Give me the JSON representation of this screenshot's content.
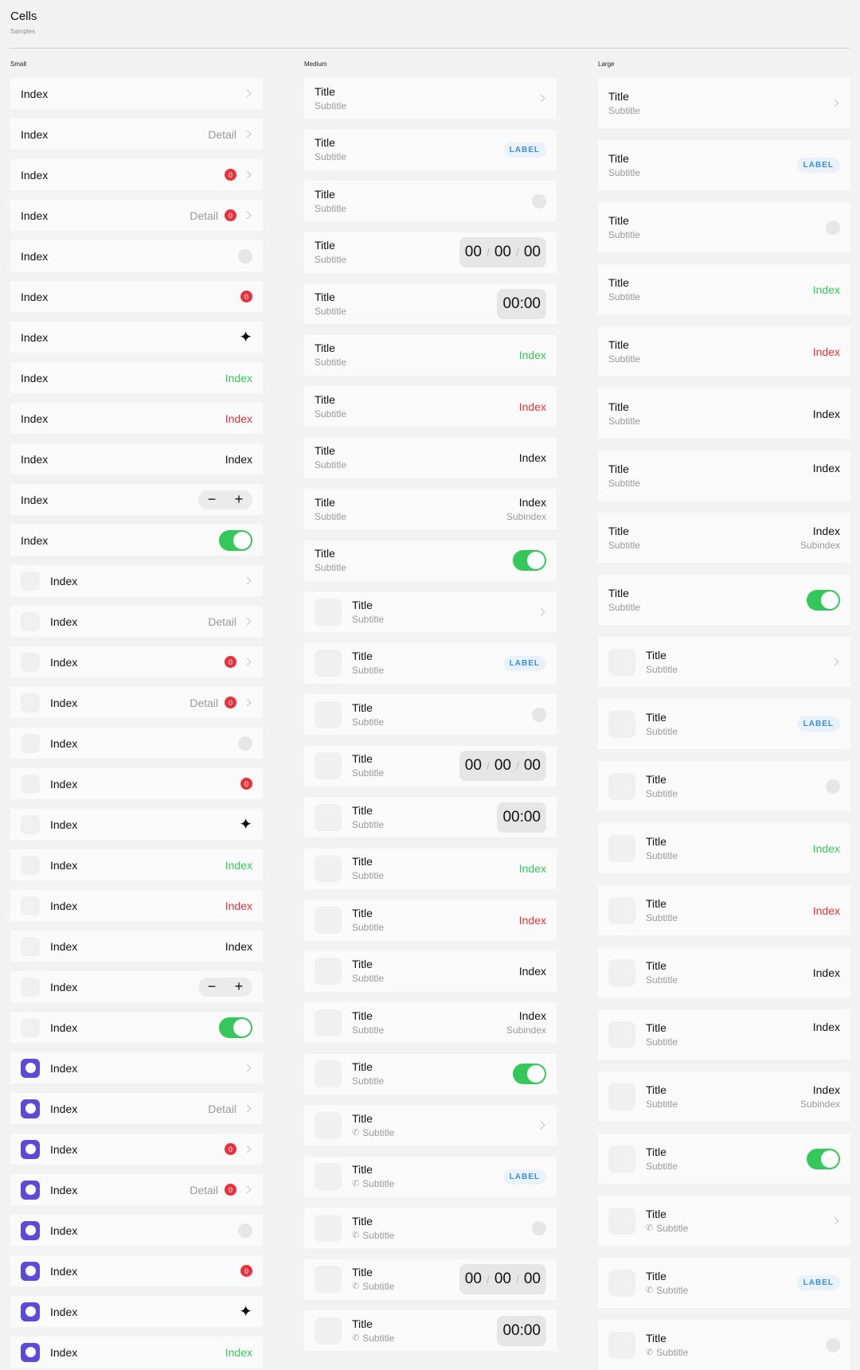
{
  "header": {
    "title": "Cells",
    "subtitle": "Samples"
  },
  "columns": {
    "small": "Small",
    "medium": "Medium",
    "large": "Large"
  },
  "common": {
    "index": "Index",
    "title": "Title",
    "subtitle": "Subtitle",
    "detail": "Detail",
    "badge": "0",
    "label": "LABEL",
    "subindex": "Subindex",
    "timer_h": "00",
    "timer_m": "00",
    "timer_s": "00",
    "timer_short": "00:00",
    "minus": "−",
    "plus": "+",
    "sparkle": "✦"
  },
  "colors": {
    "accent_green": "#34c759",
    "accent_red": "#e8313a",
    "label_blue": "#3a8fd9",
    "icon_purple": "#5b4bd8"
  },
  "small_rows": [
    {
      "thumb": "none",
      "right": "chevron"
    },
    {
      "thumb": "none",
      "right": "detail-chevron"
    },
    {
      "thumb": "none",
      "right": "badge-chevron"
    },
    {
      "thumb": "none",
      "right": "detail-badge-chevron"
    },
    {
      "thumb": "none",
      "right": "radio"
    },
    {
      "thumb": "none",
      "right": "badge"
    },
    {
      "thumb": "none",
      "right": "sparkle"
    },
    {
      "thumb": "none",
      "right": "value-green"
    },
    {
      "thumb": "none",
      "right": "value-red"
    },
    {
      "thumb": "none",
      "right": "value"
    },
    {
      "thumb": "none",
      "right": "stepper"
    },
    {
      "thumb": "none",
      "right": "toggle"
    },
    {
      "thumb": "grey",
      "right": "chevron"
    },
    {
      "thumb": "grey",
      "right": "detail-chevron"
    },
    {
      "thumb": "grey",
      "right": "badge-chevron"
    },
    {
      "thumb": "grey",
      "right": "detail-badge-chevron"
    },
    {
      "thumb": "grey",
      "right": "radio"
    },
    {
      "thumb": "grey",
      "right": "badge"
    },
    {
      "thumb": "grey",
      "right": "sparkle"
    },
    {
      "thumb": "grey",
      "right": "value-green"
    },
    {
      "thumb": "grey",
      "right": "value-red"
    },
    {
      "thumb": "grey",
      "right": "value"
    },
    {
      "thumb": "grey",
      "right": "stepper"
    },
    {
      "thumb": "grey",
      "right": "toggle"
    },
    {
      "thumb": "purple",
      "right": "chevron"
    },
    {
      "thumb": "purple",
      "right": "detail-chevron"
    },
    {
      "thumb": "purple",
      "right": "badge-chevron"
    },
    {
      "thumb": "purple",
      "right": "detail-badge-chevron"
    },
    {
      "thumb": "purple",
      "right": "radio"
    },
    {
      "thumb": "purple",
      "right": "badge"
    },
    {
      "thumb": "purple",
      "right": "sparkle"
    },
    {
      "thumb": "purple",
      "right": "value-green"
    }
  ],
  "medium_rows": [
    {
      "thumb": "none",
      "phone": false,
      "right": "chevron"
    },
    {
      "thumb": "none",
      "phone": false,
      "right": "label"
    },
    {
      "thumb": "none",
      "phone": false,
      "right": "radio"
    },
    {
      "thumb": "none",
      "phone": false,
      "right": "timer-long"
    },
    {
      "thumb": "none",
      "phone": false,
      "right": "timer-short"
    },
    {
      "thumb": "none",
      "phone": false,
      "right": "value-green"
    },
    {
      "thumb": "none",
      "phone": false,
      "right": "value-red"
    },
    {
      "thumb": "none",
      "phone": false,
      "right": "value"
    },
    {
      "thumb": "none",
      "phone": false,
      "right": "value-sub"
    },
    {
      "thumb": "none",
      "phone": false,
      "right": "toggle"
    },
    {
      "thumb": "grey",
      "phone": false,
      "right": "chevron"
    },
    {
      "thumb": "grey",
      "phone": false,
      "right": "label"
    },
    {
      "thumb": "grey",
      "phone": false,
      "right": "radio"
    },
    {
      "thumb": "grey",
      "phone": false,
      "right": "timer-long"
    },
    {
      "thumb": "grey",
      "phone": false,
      "right": "timer-short"
    },
    {
      "thumb": "grey",
      "phone": false,
      "right": "value-green"
    },
    {
      "thumb": "grey",
      "phone": false,
      "right": "value-red"
    },
    {
      "thumb": "grey",
      "phone": false,
      "right": "value"
    },
    {
      "thumb": "grey",
      "phone": false,
      "right": "value-sub"
    },
    {
      "thumb": "grey",
      "phone": false,
      "right": "toggle"
    },
    {
      "thumb": "grey",
      "phone": true,
      "right": "chevron"
    },
    {
      "thumb": "grey",
      "phone": true,
      "right": "label"
    },
    {
      "thumb": "grey",
      "phone": true,
      "right": "radio"
    },
    {
      "thumb": "grey",
      "phone": true,
      "right": "timer-long"
    },
    {
      "thumb": "grey",
      "phone": true,
      "right": "timer-short"
    }
  ],
  "large_rows": [
    {
      "thumb": "none",
      "phone": false,
      "right": "chevron"
    },
    {
      "thumb": "none",
      "phone": false,
      "right": "label"
    },
    {
      "thumb": "none",
      "phone": false,
      "right": "radio"
    },
    {
      "thumb": "none",
      "phone": false,
      "right": "value-green"
    },
    {
      "thumb": "none",
      "phone": false,
      "right": "value-red"
    },
    {
      "thumb": "none",
      "phone": false,
      "right": "value"
    },
    {
      "thumb": "none",
      "phone": false,
      "right": "value-top"
    },
    {
      "thumb": "none",
      "phone": false,
      "right": "value-sub"
    },
    {
      "thumb": "none",
      "phone": false,
      "right": "toggle"
    },
    {
      "thumb": "grey",
      "phone": false,
      "right": "chevron"
    },
    {
      "thumb": "grey",
      "phone": false,
      "right": "label"
    },
    {
      "thumb": "grey",
      "phone": false,
      "right": "radio"
    },
    {
      "thumb": "grey",
      "phone": false,
      "right": "value-green"
    },
    {
      "thumb": "grey",
      "phone": false,
      "right": "value-red"
    },
    {
      "thumb": "grey",
      "phone": false,
      "right": "value"
    },
    {
      "thumb": "grey",
      "phone": false,
      "right": "value-top"
    },
    {
      "thumb": "grey",
      "phone": false,
      "right": "value-sub"
    },
    {
      "thumb": "grey",
      "phone": false,
      "right": "toggle"
    },
    {
      "thumb": "grey",
      "phone": true,
      "right": "chevron"
    },
    {
      "thumb": "grey",
      "phone": true,
      "right": "label"
    },
    {
      "thumb": "grey",
      "phone": true,
      "right": "radio"
    }
  ]
}
